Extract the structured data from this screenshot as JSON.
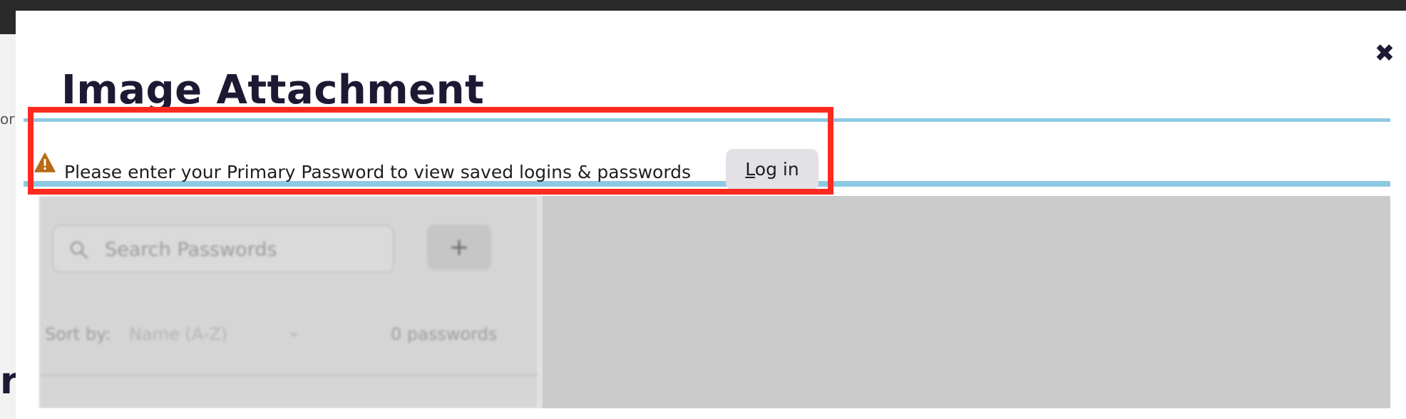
{
  "background": {
    "fragment_left": "or",
    "fragment_bottom": "r"
  },
  "modal": {
    "title": "Image Attachment",
    "close_icon": "close-icon",
    "close_glyph": "✖"
  },
  "attachment": {
    "banner": {
      "warning_icon": "warning-icon",
      "message": "Please enter your Primary Password to view saved logins & passwords",
      "login_label_accesskey": "L",
      "login_label_rest": "og in",
      "border_color": "#8ec9e3"
    },
    "passwords": {
      "search_placeholder": "Search Passwords",
      "add_label": "+",
      "sort_label": "Sort by:",
      "sort_value": "Name (A-Z)",
      "count": "0 passwords"
    }
  },
  "highlight": {
    "color": "#ff2a1f"
  }
}
